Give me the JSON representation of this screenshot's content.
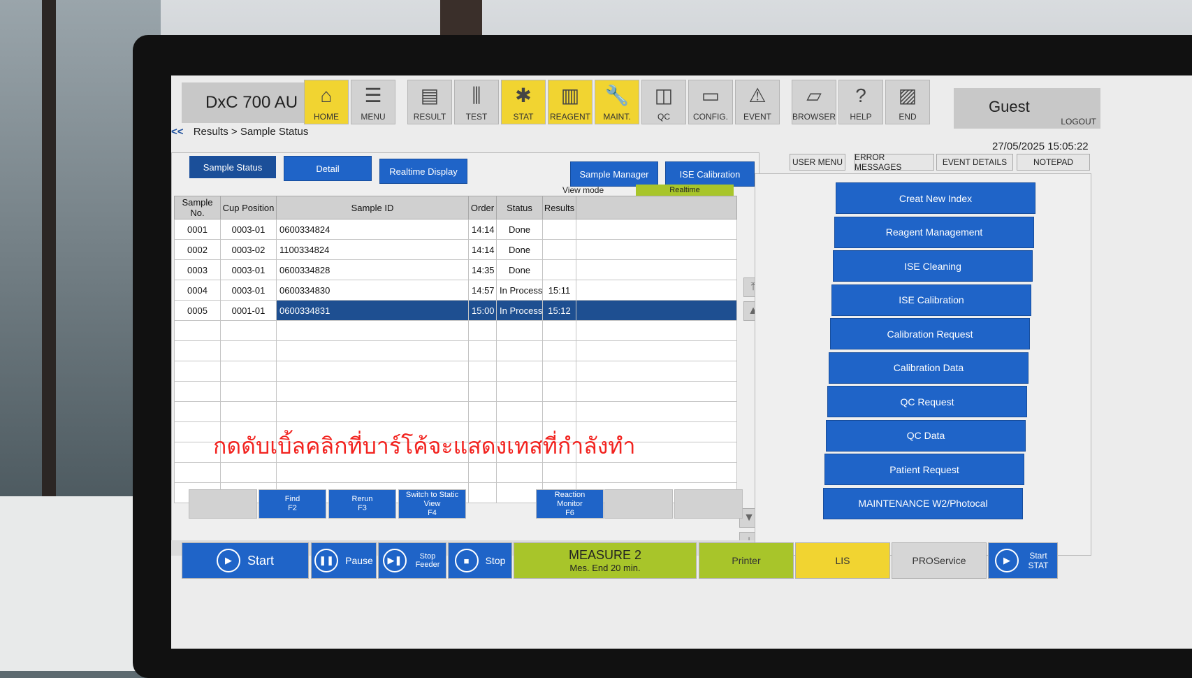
{
  "app": {
    "title": "DxC 700 AU",
    "user": "Guest",
    "logout_label": "LOGOUT",
    "datetime": "27/05/2025 15:05:22"
  },
  "toolbar": [
    {
      "label": "HOME",
      "icon": "home-icon",
      "glyph": "⌂",
      "color": "yellow"
    },
    {
      "label": "MENU",
      "icon": "menu-icon",
      "glyph": "☰",
      "color": "gray"
    },
    {
      "label": "RESULT",
      "icon": "result-icon",
      "glyph": "▤",
      "color": "gray"
    },
    {
      "label": "TEST",
      "icon": "test-icon",
      "glyph": "⫼",
      "color": "gray"
    },
    {
      "label": "STAT",
      "icon": "stat-icon",
      "glyph": "✱",
      "color": "yellow"
    },
    {
      "label": "REAGENT",
      "icon": "reagent-icon",
      "glyph": "▥",
      "color": "yellow"
    },
    {
      "label": "MAINT.",
      "icon": "wrench-icon",
      "glyph": "🔧",
      "color": "yellow"
    },
    {
      "label": "QC",
      "icon": "qc-icon",
      "glyph": "◫",
      "color": "gray"
    },
    {
      "label": "CONFIG.",
      "icon": "folder-icon",
      "glyph": "▭",
      "color": "gray"
    },
    {
      "label": "EVENT",
      "icon": "event-icon",
      "glyph": "⚠",
      "color": "gray"
    },
    {
      "label": "BROWSER",
      "icon": "browser-icon",
      "glyph": "▱",
      "color": "gray"
    },
    {
      "label": "HELP",
      "icon": "help-icon",
      "glyph": "?",
      "color": "gray"
    },
    {
      "label": "END",
      "icon": "end-icon",
      "glyph": "▨",
      "color": "gray"
    }
  ],
  "breadcrumb": {
    "back": "<<",
    "path": "Results > Sample Status"
  },
  "view_tabs": [
    "Sample Status",
    "Detail",
    "Realtime Display",
    "Sample Manager",
    "ISE Calibration"
  ],
  "view_mode": {
    "label": "View mode",
    "value": "Realtime"
  },
  "table": {
    "headers": [
      "Sample No.",
      "Cup Position",
      "Sample ID",
      "Order",
      "Status",
      "Results"
    ],
    "rows": [
      {
        "no": "0001",
        "cup": "0003-01",
        "id": "0600334824",
        "order": "14:14",
        "status": "Done",
        "results": ""
      },
      {
        "no": "0002",
        "cup": "0003-02",
        "id": "1100334824",
        "order": "14:14",
        "status": "Done",
        "results": ""
      },
      {
        "no": "0003",
        "cup": "0003-01",
        "id": "0600334828",
        "order": "14:35",
        "status": "Done",
        "results": ""
      },
      {
        "no": "0004",
        "cup": "0003-01",
        "id": "0600334830",
        "order": "14:57",
        "status": "In Process",
        "results": "15:11"
      },
      {
        "no": "0005",
        "cup": "0001-01",
        "id": "0600334831",
        "order": "15:00",
        "status": "In Process",
        "results": "15:12"
      }
    ],
    "selected_index": 4
  },
  "annotation": "กดดับเบิ้ลคลิกที่บาร์โค้จะแสดงเทสที่กำลังทำ",
  "function_keys": [
    {
      "l1": "Find",
      "l2": "F2"
    },
    {
      "l1": "Rerun",
      "l2": "F3"
    },
    {
      "l1": "Switch to Static View",
      "l2": "F4"
    },
    {
      "l1": "Reaction Monitor",
      "l2": "F6"
    }
  ],
  "right_tabs": [
    "USER MENU",
    "ERROR MESSAGES",
    "EVENT DETAILS",
    "NOTEPAD"
  ],
  "user_menu": [
    "Creat New Index",
    "Reagent Management",
    "ISE Cleaning",
    "ISE Calibration",
    "Calibration Request",
    "Calibration Data",
    "QC Request",
    "QC Data",
    "Patient Request",
    "MAINTENANCE W2/Photocal"
  ],
  "bottom": {
    "start": "Start",
    "pause": "Pause",
    "stop_feeder": "Stop Feeder",
    "stop": "Stop",
    "measure_title": "MEASURE 2",
    "measure_sub": "Mes. End 20 min.",
    "printer": "Printer",
    "lis": "LIS",
    "proservice": "PROService",
    "start_stat": "Start STAT"
  },
  "colors": {
    "accent_blue": "#1f64c8",
    "selected_row": "#1e4f91",
    "yellow": "#f1d431",
    "green_status": "#a8c52a",
    "annotation_red": "#f2231f"
  }
}
